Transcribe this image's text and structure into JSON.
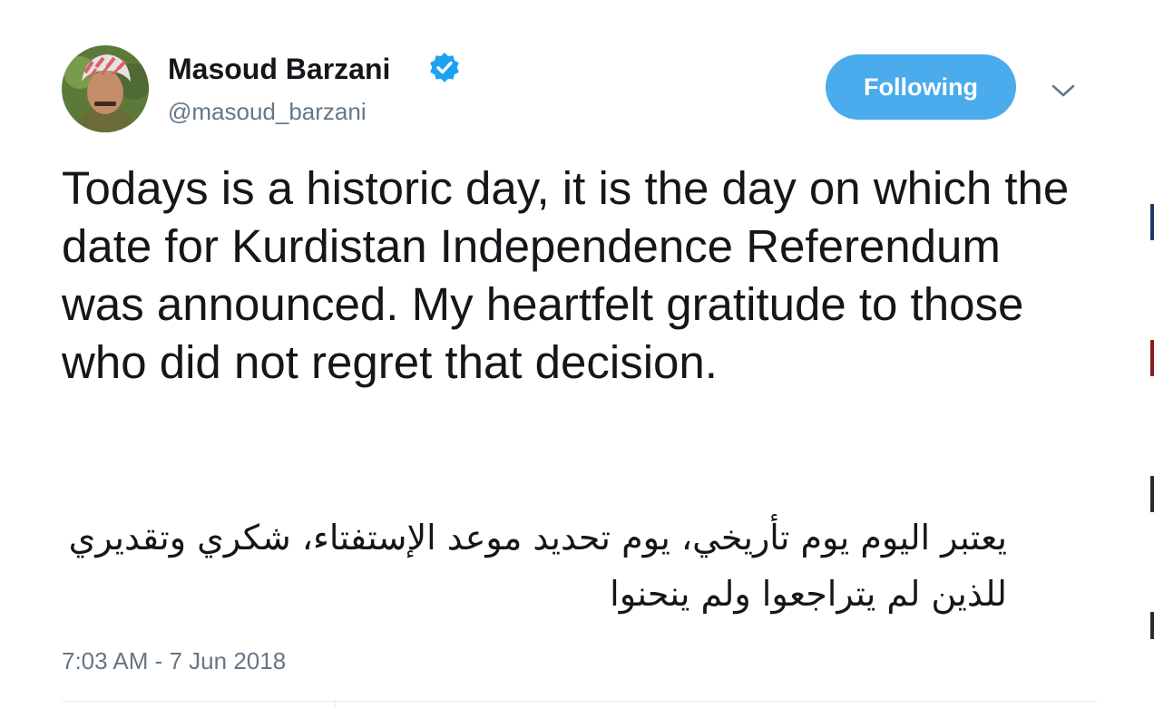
{
  "tweet": {
    "display_name": "Masoud Barzani",
    "handle": "@masoud_barzani",
    "verified": true,
    "follow_label": "Following",
    "text_en": "Todays is a historic day, it is the day on which the date for Kurdistan Independence Referendum was announced. My heartfelt gratitude to those who did not regret that decision.",
    "text_ar": "يعتبر اليوم يوم تأريخي، يوم تحديد موعد الإستفتاء، شكري وتقديري للذين لم يتراجعوا ولم ينحنوا",
    "timestamp": "7:03 AM - 7 Jun 2018"
  },
  "icons": {
    "verified": "verified-badge-icon",
    "menu": "chevron-down-icon"
  },
  "colors": {
    "accent": "#4aabed",
    "verified": "#1da1f2",
    "text": "#14171a",
    "muted": "#657786",
    "divider": "#e6ecf0"
  }
}
